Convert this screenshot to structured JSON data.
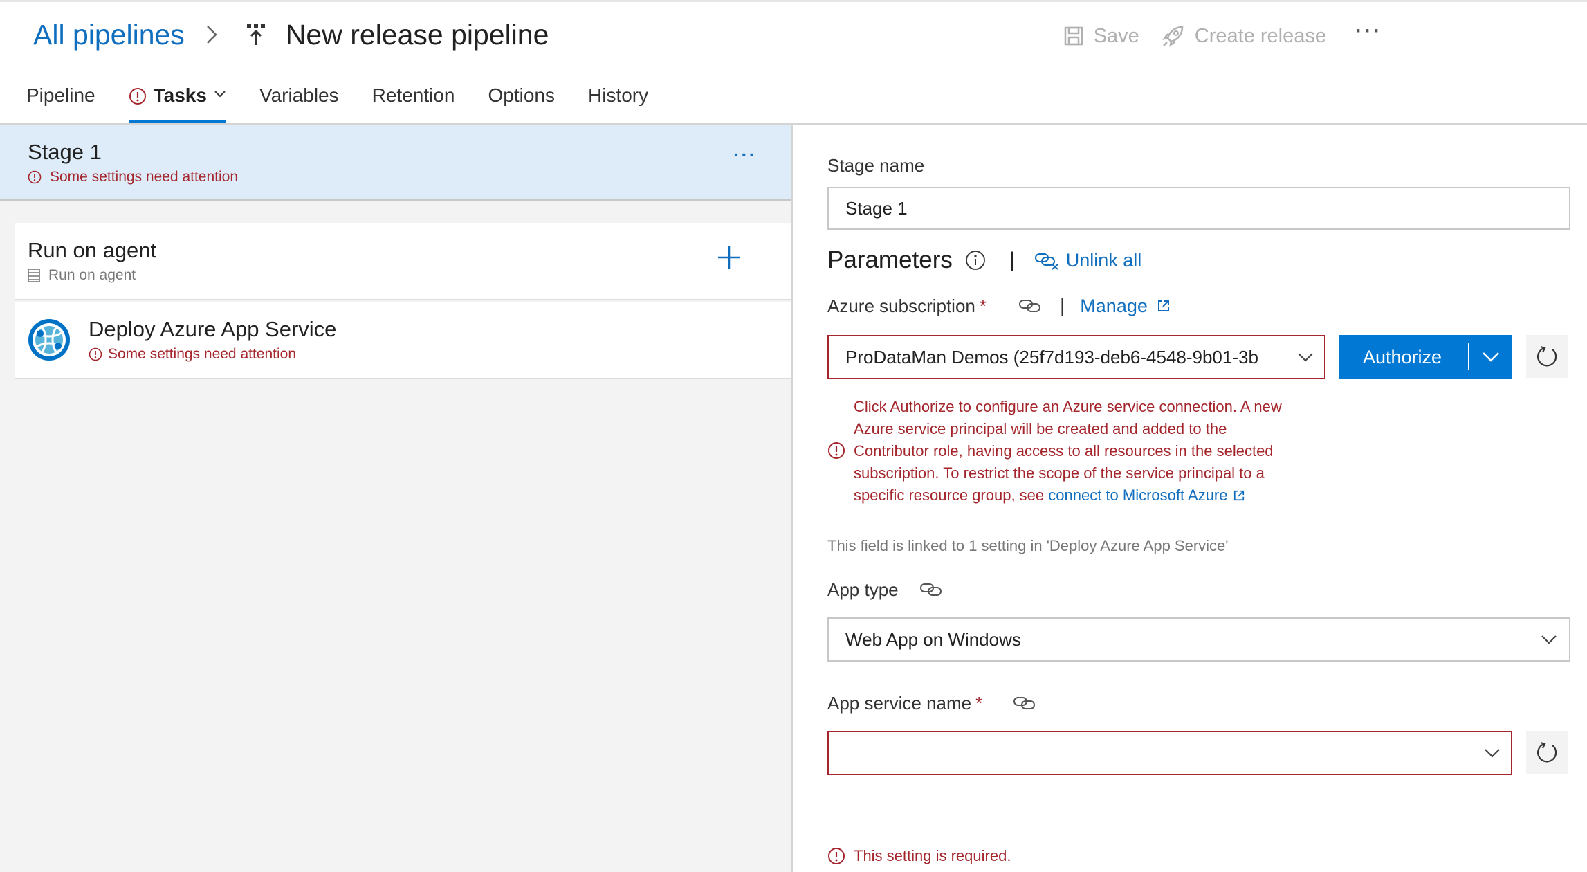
{
  "header": {
    "breadcrumb_root": "All pipelines",
    "title": "New release pipeline",
    "actions": {
      "save": "Save",
      "create_release": "Create release",
      "more": "···"
    }
  },
  "tabs": [
    {
      "label": "Pipeline"
    },
    {
      "label": "Tasks",
      "warning": true,
      "active": true
    },
    {
      "label": "Variables"
    },
    {
      "label": "Retention"
    },
    {
      "label": "Options"
    },
    {
      "label": "History"
    }
  ],
  "left": {
    "stage": {
      "name": "Stage 1",
      "warning": "Some settings need attention",
      "more": "···"
    },
    "job": {
      "name": "Run on agent",
      "sub": "Run on agent"
    },
    "task": {
      "name": "Deploy Azure App Service",
      "warning": "Some settings need attention"
    }
  },
  "right": {
    "stage_name_label": "Stage name",
    "stage_name_value": "Stage 1",
    "parameters_title": "Parameters",
    "unlink_all": "Unlink all",
    "azure_subscription": {
      "label": "Azure subscription",
      "required": "*",
      "manage": "Manage",
      "value": "ProDataMan Demos (25f7d193-deb6-4548-9b01-3b",
      "authorize": "Authorize",
      "error_lines": [
        "Click Authorize to configure an Azure service connection. A new",
        "Azure service principal will be created and added to the",
        "Contributor role, having access to all resources in the selected",
        "subscription. To restrict the scope of the service principal to a"
      ],
      "error_last_prefix": "specific resource group, see ",
      "error_link": "connect to Microsoft Azure"
    },
    "linked_note": "This field is linked to 1 setting in 'Deploy Azure App Service'",
    "app_type": {
      "label": "App type",
      "value": "Web App on Windows"
    },
    "app_service_name": {
      "label": "App service name",
      "required": "*",
      "value": "",
      "error": "This setting is required."
    }
  },
  "colors": {
    "accent": "#0078d4",
    "link": "#106ebe",
    "error": "#a4262c",
    "selected_row": "#deecf9"
  }
}
